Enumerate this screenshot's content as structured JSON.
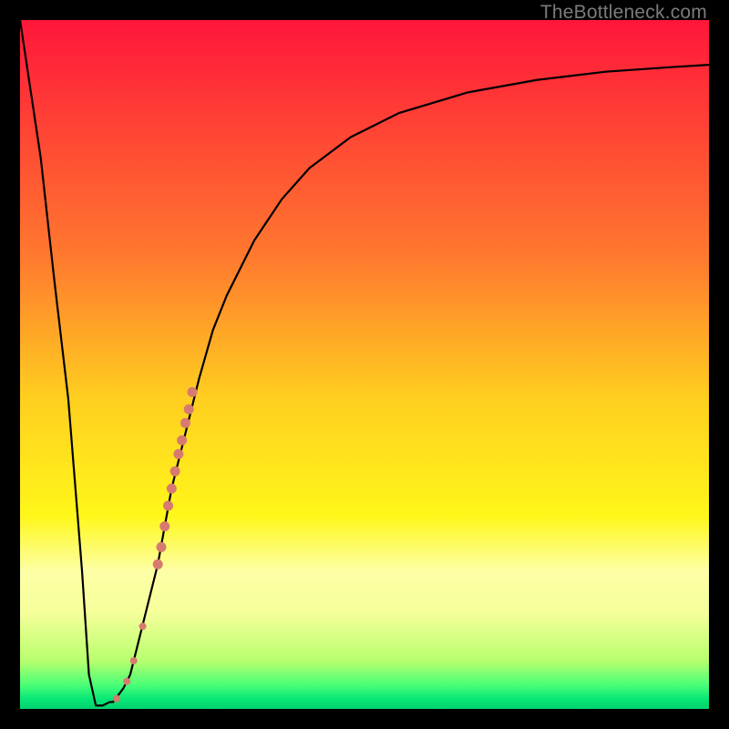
{
  "watermark": "TheBottleneck.com",
  "chart_data": {
    "type": "line",
    "title": "",
    "xlabel": "",
    "ylabel": "",
    "xlim": [
      0,
      100
    ],
    "ylim": [
      0,
      100
    ],
    "curve": {
      "x": [
        0,
        3,
        5,
        7,
        9,
        10,
        11,
        12,
        13,
        13.5,
        15,
        16,
        18,
        20,
        22,
        24,
        26,
        28,
        30,
        34,
        38,
        42,
        48,
        55,
        65,
        75,
        85,
        95,
        100
      ],
      "y": [
        100,
        80,
        62,
        45,
        20,
        5,
        0.5,
        0.5,
        1,
        1,
        3,
        5,
        13,
        21,
        32,
        40,
        48,
        55,
        60,
        68,
        74,
        78.5,
        83,
        86.5,
        89.5,
        91.3,
        92.5,
        93.2,
        93.5
      ]
    },
    "markers": {
      "color": "#d77a6f",
      "x": [
        14.0,
        15.5,
        16.5,
        17.8,
        20.0,
        20.5,
        21.0,
        21.5,
        22.0,
        22.5,
        23.0,
        23.5,
        24.0,
        24.5,
        25.0
      ],
      "y": [
        1.5,
        4.0,
        7.0,
        12.0,
        21.0,
        23.5,
        26.5,
        29.5,
        32.0,
        34.5,
        37.0,
        39.0,
        41.5,
        43.5,
        46.0
      ],
      "r": [
        4.0,
        4.0,
        4.0,
        4.0,
        5.5,
        5.5,
        5.5,
        5.5,
        5.5,
        5.5,
        5.5,
        5.5,
        5.5,
        5.5,
        5.5
      ]
    },
    "gradient_stops": [
      {
        "offset": 0.0,
        "color": "#ff163a"
      },
      {
        "offset": 0.35,
        "color": "#ff7b2e"
      },
      {
        "offset": 0.55,
        "color": "#ffcf1f"
      },
      {
        "offset": 0.72,
        "color": "#fff71a"
      },
      {
        "offset": 0.8,
        "color": "#fdffa6"
      },
      {
        "offset": 0.86,
        "color": "#f6ff9a"
      },
      {
        "offset": 0.93,
        "color": "#b8ff6e"
      },
      {
        "offset": 0.965,
        "color": "#4bff77"
      },
      {
        "offset": 0.985,
        "color": "#08e876"
      },
      {
        "offset": 1.0,
        "color": "#02d06e"
      }
    ]
  }
}
